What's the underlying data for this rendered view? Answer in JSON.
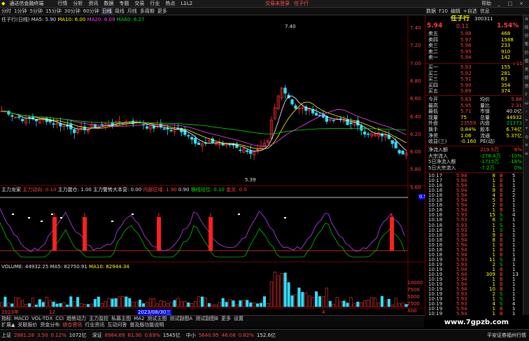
{
  "app": {
    "title": "通达信金融终端",
    "notice": "交易未登录",
    "stock_link": "任子行"
  },
  "menu": [
    "行情",
    "分析",
    "资讯",
    "数据",
    "专题",
    "交易",
    "行业",
    "热点",
    "L1L2"
  ],
  "window_buttons": {
    "help": "帮助",
    "min": "_",
    "max": "□",
    "close": "×"
  },
  "toolbar": {
    "periods": [
      "分时",
      "1分钟",
      "5分钟",
      "15分钟",
      "30分钟",
      "60分钟",
      "日线",
      "周线",
      "月线",
      "多周期",
      "更多"
    ],
    "active": "日线"
  },
  "right_tools": [
    "数据",
    "F10",
    "编辑",
    "+自选",
    "信息"
  ],
  "chart": {
    "info_line": {
      "name": "任子行(日线)",
      "ma5": "MA5: 5.90",
      "ma10": "MA10: 6.00",
      "ma20": "MA20: 6.09",
      "ma60": "MA60: 6.27"
    },
    "price_labels": [
      "7.40",
      "7.20",
      "7.00",
      "6.80",
      "6.60",
      "6.40",
      "6.20",
      "6.00",
      "5.80",
      "5.60"
    ],
    "high_mark": "7.40",
    "low_mark": "5.39",
    "indicator_line": {
      "main": "主力龙家",
      "a": "主力动向: 0.10",
      "b": "主力震仓: 1.00",
      "c": "主力警势大本营: 0.00",
      "d": "内部区域: 1.90",
      "e": "0.90",
      "f": "横线站位: 0.10",
      "g": "金叉: 0.0"
    },
    "ind_labels": [
      "0.90"
    ],
    "vol_line": {
      "volume": "VOLUME: 44932.25",
      "ma5": "MA5: 82750.91",
      "ma10": "MA10: 82944.34"
    },
    "vol_labels": [
      "10000",
      "7500",
      "5000",
      "2500",
      "X00"
    ],
    "date_labels": [
      "2023年",
      "12",
      "2023/08/30三",
      "4"
    ]
  },
  "quote": {
    "name": "任子行",
    "code": "300311",
    "price": "5.94",
    "chg": "0.11",
    "pct": "1.54%",
    "asks": [
      {
        "l": "卖五",
        "p": "5.98",
        "v": "468"
      },
      {
        "l": "卖四",
        "p": "5.97",
        "v": "1588"
      },
      {
        "l": "卖三",
        "p": "5.96",
        "v": "233"
      },
      {
        "l": "卖二",
        "p": "5.95",
        "v": "910"
      },
      {
        "l": "卖一",
        "p": "5.94",
        "v": "142"
      }
    ],
    "ask_extra": "+111",
    "bids": [
      {
        "l": "买一",
        "p": "5.93",
        "v": "155"
      },
      {
        "l": "买二",
        "p": "5.92",
        "v": "281"
      },
      {
        "l": "买三",
        "p": "5.91",
        "v": "63"
      },
      {
        "l": "买四",
        "p": "5.90",
        "v": "354"
      },
      {
        "l": "买五",
        "p": "5.89",
        "v": "374"
      }
    ],
    "stats": [
      {
        "a": "今开",
        "b": "5.83",
        "c": "均价",
        "d": "5.88"
      },
      {
        "a": "最高",
        "b": "5.95",
        "c": "量比",
        "d": "2.31"
      },
      {
        "a": "最低",
        "b": "5.71",
        "c": "市值",
        "d": "40.0亿"
      },
      {
        "a": "现量",
        "b": "75",
        "c": "总量",
        "d": "44932"
      },
      {
        "a": "外盘",
        "b": "23559",
        "c": "内盘",
        "d": "21373"
      },
      {
        "a": "换手",
        "b": "0.84%",
        "c": "股本",
        "d": "6.74亿"
      },
      {
        "a": "净资",
        "b": "1.06",
        "c": "流通",
        "d": "5.37亿"
      },
      {
        "a": "收益(三)",
        "b": "-0.160",
        "c": "PE(动)",
        "d": ""
      }
    ],
    "flows": [
      {
        "a": "净流入额",
        "b": "219.5万",
        "c": "8%"
      },
      {
        "a": "大宗流入",
        "b": "-278.4万",
        "c": "-10%"
      },
      {
        "a": "5日净流入额",
        "b": "-1715万",
        "c": "-18%"
      },
      {
        "a": "5日大宗流入",
        "b": "-7.2万",
        "c": "0%"
      }
    ],
    "ticks": [
      {
        "t": "10:17",
        "p": "5.94",
        "v": "8",
        "s": "B",
        "n": "5"
      },
      {
        "t": "10:17",
        "p": "5.94",
        "v": "1",
        "s": "B",
        "n": "1"
      },
      {
        "t": "10:18",
        "p": "5.94",
        "v": "1",
        "s": "B",
        "n": "1"
      },
      {
        "t": "10:18",
        "p": "5.94",
        "v": "9",
        "s": "B",
        "n": "2"
      },
      {
        "t": "10:18",
        "p": "5.94",
        "v": "4",
        "s": "B",
        "n": "2"
      },
      {
        "t": "10:18",
        "p": "5.94",
        "v": "5",
        "s": "B",
        "n": "1"
      },
      {
        "t": "10:18",
        "p": "5.94",
        "v": "2",
        "s": "B",
        "n": "1"
      },
      {
        "t": "10:18",
        "p": "5.94",
        "v": "1",
        "s": "B",
        "n": "1"
      },
      {
        "t": "10:18",
        "p": "5.93",
        "v": "15",
        "s": "S",
        "n": "4"
      },
      {
        "t": "10:18",
        "p": "5.93",
        "v": "6",
        "s": "S",
        "n": "1"
      },
      {
        "t": "10:18",
        "p": "5.93",
        "v": "1",
        "s": "S",
        "n": "1"
      },
      {
        "t": "10:18",
        "p": "5.93",
        "v": "1",
        "s": "S",
        "n": "1"
      },
      {
        "t": "10:18",
        "p": "5.94",
        "v": "9",
        "s": "B",
        "n": "1"
      },
      {
        "t": "10:18",
        "p": "5.94",
        "v": "8",
        "s": "B",
        "n": "1"
      },
      {
        "t": "10:18",
        "p": "5.94",
        "v": "1",
        "s": "B",
        "n": "1"
      },
      {
        "t": "10:18",
        "p": "5.94",
        "v": "1",
        "s": "B",
        "n": "1"
      },
      {
        "t": "10:18",
        "p": "5.94",
        "v": "1",
        "s": "B",
        "n": "1"
      },
      {
        "t": "10:19",
        "p": "5.93",
        "v": "11",
        "s": "S",
        "n": "3"
      },
      {
        "t": "10:19",
        "p": "5.93",
        "v": "2",
        "s": "S",
        "n": "1"
      },
      {
        "t": "10:19",
        "p": "5.94",
        "v": "1",
        "s": "B",
        "n": "1"
      },
      {
        "t": "10:19",
        "p": "5.94",
        "v": "309",
        "s": "B",
        "n": "13"
      },
      {
        "t": "10:19",
        "p": "5.94",
        "v": "1",
        "s": "B",
        "n": "1"
      },
      {
        "t": "10:19",
        "p": "5.94",
        "v": "1",
        "s": "B",
        "n": "1"
      },
      {
        "t": "10:19",
        "p": "5.94",
        "v": "10",
        "s": "B",
        "n": "1"
      },
      {
        "t": "10:19",
        "p": "5.93",
        "v": "2",
        "s": "S",
        "n": "1"
      },
      {
        "t": "10:19",
        "p": "5.93",
        "v": "1",
        "s": "S",
        "n": "1"
      },
      {
        "t": "10:19",
        "p": "5.93",
        "v": "4",
        "s": "S",
        "n": "4"
      },
      {
        "t": "10:19",
        "p": "5.94",
        "v": "1",
        "s": "B",
        "n": "1"
      },
      {
        "t": "10:19",
        "p": "5.94",
        "v": "1",
        "s": "B",
        "n": "1"
      },
      {
        "t": "10:19",
        "p": "5.94",
        "v": "1",
        "s": "B",
        "n": "1"
      }
    ]
  },
  "sidebar": [
    "A",
    "技",
    "分",
    "笔",
    "价",
    "盘",
    "关",
    "综",
    "资",
    "F",
    "ω",
    "‹",
    "»",
    "+",
    "◎",
    "✕",
    "≡"
  ],
  "tabs1": [
    "指标",
    "MACD",
    "VOL-TDX",
    "CCI",
    "趋势动力",
    "主力监控",
    "私募主图",
    "MA2",
    "测试主图",
    "测试副图A",
    "测试副图B",
    "更多",
    "设置"
  ],
  "tabs2": [
    "扩展▲",
    "关联报价",
    "资金分布",
    "综合资讯",
    "行业资讯",
    "互动问答",
    "普及版功能说明"
  ],
  "status": [
    {
      "n": "上证",
      "v": "2881.28",
      "c": "3.50",
      "p": "0.12%",
      "a": "1072亿"
    },
    {
      "n": "深证",
      "v": "8984.69",
      "c": "61.90",
      "p": "0.69%",
      "a": "1545亿"
    },
    {
      "n": "中小",
      "v": "5640.95",
      "c": "46.08",
      "p": "0.82%",
      "a": "152.6亿"
    }
  ],
  "status_right": "平安证券福州行情",
  "watermark": "www.7gpzb.com",
  "clock": "10:20:29"
}
